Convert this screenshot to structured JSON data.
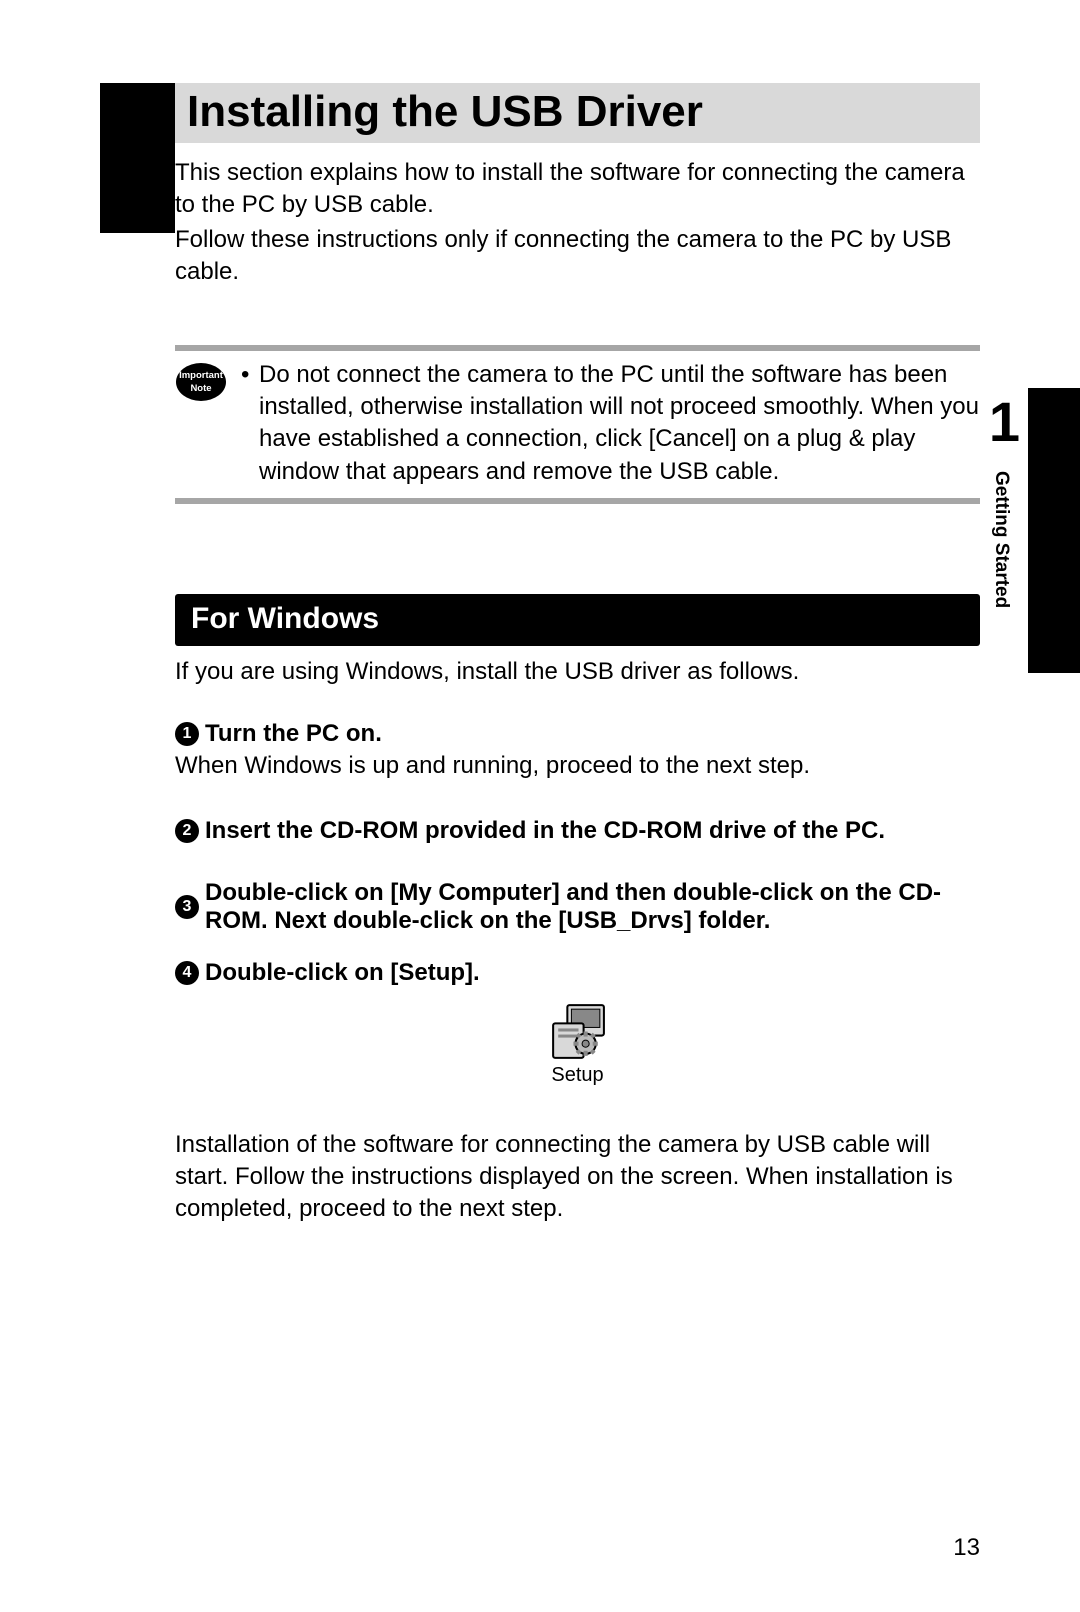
{
  "header": {
    "title": "Installing the USB Driver"
  },
  "intro": {
    "line1": "This section explains how to install the software for connecting the camera to the PC by USB cable.",
    "line2": "Follow these instructions only if connecting the camera to the PC by USB cable."
  },
  "note": {
    "badge_top": "Important",
    "badge_bottom": "Note",
    "text": "Do not connect the camera to the PC until the software has been installed, otherwise installation will not proceed smoothly. When you have established a connection, click [Cancel] on a plug & play window that appears and remove the USB cable."
  },
  "section": {
    "title": "For Windows",
    "intro": "If you are using Windows, install the USB driver as follows."
  },
  "steps": [
    {
      "num": "1",
      "title": "Turn the PC on.",
      "body": "When Windows is up and running, proceed to the next step."
    },
    {
      "num": "2",
      "title": "Insert the CD-ROM provided in the CD-ROM drive of the PC.",
      "body": ""
    },
    {
      "num": "3",
      "title": "Double-click on [My Computer] and then double-click on the CD-ROM. Next double-click on the [USB_Drvs] folder.",
      "body": ""
    },
    {
      "num": "4",
      "title": "Double-click on [Setup].",
      "body": ""
    }
  ],
  "setup_icon_label": "Setup",
  "post": "Installation of the software for connecting the camera by USB cable will start. Follow the instructions displayed on the screen. When installation is completed, proceed to the next step.",
  "side": {
    "chapter_number": "1",
    "chapter_title": "Getting Started"
  },
  "page_number": "13"
}
